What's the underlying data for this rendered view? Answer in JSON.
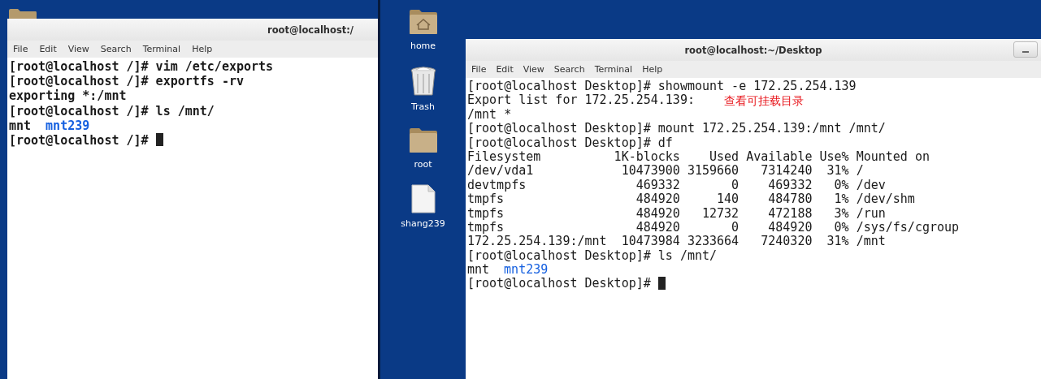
{
  "left_pane": {
    "terminal": {
      "title": "root@localhost:/",
      "menu": [
        "File",
        "Edit",
        "View",
        "Search",
        "Terminal",
        "Help"
      ],
      "lines": [
        {
          "kind": "text",
          "text": "[root@localhost /]# vim /etc/exports"
        },
        {
          "kind": "text",
          "text": "[root@localhost /]# exportfs -rv"
        },
        {
          "kind": "text",
          "text": "exporting *:/mnt"
        },
        {
          "kind": "text",
          "text": "[root@localhost /]# ls /mnt/"
        },
        {
          "kind": "listing",
          "entries": [
            {
              "name": "mnt",
              "color": "#1a1a1a"
            },
            {
              "name": "mnt239",
              "color": "#1560e0"
            }
          ]
        },
        {
          "kind": "prompt",
          "text": "[root@localhost /]# ",
          "cursor": true
        }
      ]
    }
  },
  "right_pane": {
    "desktop_icons": [
      {
        "kind": "home",
        "label": "home"
      },
      {
        "kind": "trash",
        "label": "Trash"
      },
      {
        "kind": "folder",
        "label": "root"
      },
      {
        "kind": "file",
        "label": "shang239"
      }
    ],
    "terminal": {
      "title": "root@localhost:~/Desktop",
      "menu": [
        "File",
        "Edit",
        "View",
        "Search",
        "Terminal",
        "Help"
      ],
      "annotation": "查看可挂载目录",
      "lines": [
        {
          "kind": "text",
          "text": "[root@localhost Desktop]# showmount -e 172.25.254.139"
        },
        {
          "kind": "text",
          "text": "Export list for 172.25.254.139:"
        },
        {
          "kind": "text",
          "text": "/mnt *"
        },
        {
          "kind": "text",
          "text": "[root@localhost Desktop]# mount 172.25.254.139:/mnt /mnt/"
        },
        {
          "kind": "text",
          "text": "[root@localhost Desktop]# df"
        },
        {
          "kind": "text",
          "text": "Filesystem          1K-blocks    Used Available Use% Mounted on"
        },
        {
          "kind": "text",
          "text": "/dev/vda1            10473900 3159660   7314240  31% /"
        },
        {
          "kind": "text",
          "text": "devtmpfs               469332       0    469332   0% /dev"
        },
        {
          "kind": "text",
          "text": "tmpfs                  484920     140    484780   1% /dev/shm"
        },
        {
          "kind": "text",
          "text": "tmpfs                  484920   12732    472188   3% /run"
        },
        {
          "kind": "text",
          "text": "tmpfs                  484920       0    484920   0% /sys/fs/cgroup"
        },
        {
          "kind": "text",
          "text": "172.25.254.139:/mnt  10473984 3233664   7240320  31% /mnt"
        },
        {
          "kind": "text",
          "text": "[root@localhost Desktop]# ls /mnt/"
        },
        {
          "kind": "listing",
          "entries": [
            {
              "name": "mnt",
              "color": "#1a1a1a"
            },
            {
              "name": "mnt239",
              "color": "#1560e0"
            }
          ]
        },
        {
          "kind": "prompt",
          "text": "[root@localhost Desktop]# ",
          "cursor": true
        }
      ]
    }
  }
}
